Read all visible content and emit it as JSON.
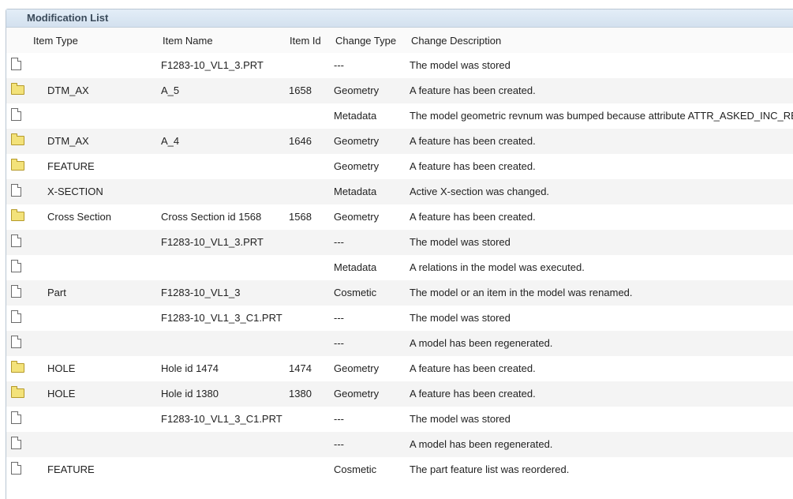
{
  "panel": {
    "title": "Modification List"
  },
  "columns": {
    "item_type": "Item Type",
    "item_name": "Item Name",
    "item_id": "Item Id",
    "change_type": "Change Type",
    "change_description": "Change Description"
  },
  "rows": [
    {
      "icon": "document-icon",
      "item_type": "",
      "item_name": "F1283-10_VL1_3.PRT",
      "item_id": "",
      "change_type": "---",
      "change_description": "The model was stored"
    },
    {
      "icon": "folder-icon",
      "item_type": "DTM_AX",
      "item_name": "A_5",
      "item_id": "1658",
      "change_type": "Geometry",
      "change_description": "A feature has been created."
    },
    {
      "icon": "document-icon",
      "item_type": "",
      "item_name": "",
      "item_id": "",
      "change_type": "Metadata",
      "change_description": "The model geometric revnum was bumped because attribute ATTR_ASKED_INC_RE"
    },
    {
      "icon": "folder-icon",
      "item_type": "DTM_AX",
      "item_name": "A_4",
      "item_id": "1646",
      "change_type": "Geometry",
      "change_description": "A feature has been created."
    },
    {
      "icon": "folder-icon",
      "item_type": "FEATURE",
      "item_name": "",
      "item_id": "",
      "change_type": "Geometry",
      "change_description": "A feature has been created."
    },
    {
      "icon": "document-icon",
      "item_type": "X-SECTION",
      "item_name": "",
      "item_id": "",
      "change_type": "Metadata",
      "change_description": "Active X-section was changed."
    },
    {
      "icon": "folder-icon",
      "item_type": "Cross Section",
      "item_name": "Cross Section id 1568",
      "item_id": "1568",
      "change_type": "Geometry",
      "change_description": "A feature has been created."
    },
    {
      "icon": "document-icon",
      "item_type": "",
      "item_name": "F1283-10_VL1_3.PRT",
      "item_id": "",
      "change_type": "---",
      "change_description": "The model was stored"
    },
    {
      "icon": "document-icon",
      "item_type": "",
      "item_name": "",
      "item_id": "",
      "change_type": "Metadata",
      "change_description": "A relations in the model was executed."
    },
    {
      "icon": "document-icon",
      "item_type": "Part",
      "item_name": "F1283-10_VL1_3",
      "item_id": "",
      "change_type": "Cosmetic",
      "change_description": "The model or an item in the model was renamed."
    },
    {
      "icon": "document-icon",
      "item_type": "",
      "item_name": "F1283-10_VL1_3_C1.PRT",
      "item_id": "",
      "change_type": "---",
      "change_description": "The model was stored"
    },
    {
      "icon": "document-icon",
      "item_type": "",
      "item_name": "",
      "item_id": "",
      "change_type": "---",
      "change_description": "A model has been regenerated."
    },
    {
      "icon": "folder-icon",
      "item_type": "HOLE",
      "item_name": "Hole id 1474",
      "item_id": "1474",
      "change_type": "Geometry",
      "change_description": "A feature has been created."
    },
    {
      "icon": "folder-icon",
      "item_type": "HOLE",
      "item_name": "Hole id 1380",
      "item_id": "1380",
      "change_type": "Geometry",
      "change_description": "A feature has been created."
    },
    {
      "icon": "document-icon",
      "item_type": "",
      "item_name": "F1283-10_VL1_3_C1.PRT",
      "item_id": "",
      "change_type": "---",
      "change_description": "The model was stored"
    },
    {
      "icon": "document-icon",
      "item_type": "",
      "item_name": "",
      "item_id": "",
      "change_type": "---",
      "change_description": "A model has been regenerated."
    },
    {
      "icon": "document-icon",
      "item_type": "FEATURE",
      "item_name": "",
      "item_id": "",
      "change_type": "Cosmetic",
      "change_description": "The part feature list was reordered."
    }
  ]
}
